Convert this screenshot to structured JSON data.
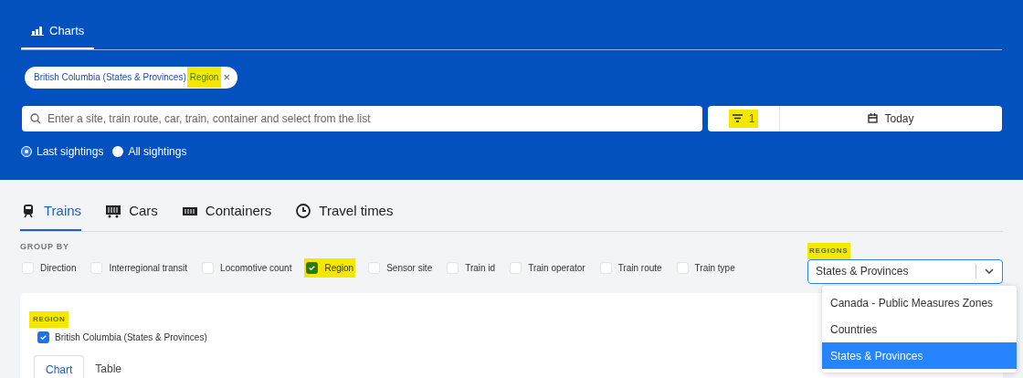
{
  "header_tabs": [
    {
      "label": "Charts",
      "selected": true
    }
  ],
  "filter_chip": {
    "text": "British Columbia (States & Provinces)",
    "tag": "Region",
    "tag_highlighted": true,
    "close": "×"
  },
  "search": {
    "placeholder": "Enter a site, train route, car, train, container and select from the list"
  },
  "filter_button": {
    "count": "1",
    "highlighted": true
  },
  "date_button": {
    "label": "Today"
  },
  "sighting_options": [
    {
      "label": "Last sightings",
      "selected": true
    },
    {
      "label": "All sightings",
      "selected": false
    }
  ],
  "main_tabs": [
    {
      "label": "Trains",
      "kind": "train",
      "selected": true
    },
    {
      "label": "Cars",
      "kind": "car",
      "selected": false
    },
    {
      "label": "Containers",
      "kind": "container",
      "selected": false
    },
    {
      "label": "Travel times",
      "kind": "clock",
      "selected": false
    }
  ],
  "group_by": {
    "title": "GROUP BY",
    "options": [
      {
        "label": "Direction",
        "checked": false,
        "highlighted": false
      },
      {
        "label": "Interregional transit",
        "checked": false,
        "highlighted": false
      },
      {
        "label": "Locomotive count",
        "checked": false,
        "highlighted": false
      },
      {
        "label": "Region",
        "checked": true,
        "highlighted": true
      },
      {
        "label": "Sensor site",
        "checked": false,
        "highlighted": false
      },
      {
        "label": "Train id",
        "checked": false,
        "highlighted": false
      },
      {
        "label": "Train operator",
        "checked": false,
        "highlighted": false
      },
      {
        "label": "Train route",
        "checked": false,
        "highlighted": false
      },
      {
        "label": "Train type",
        "checked": false,
        "highlighted": false
      }
    ]
  },
  "regions": {
    "label": "REGIONS",
    "label_highlighted": true,
    "value": "States & Provinces",
    "options": [
      {
        "label": "Canada - Public Measures Zones",
        "selected": false
      },
      {
        "label": "Countries",
        "selected": false
      },
      {
        "label": "States & Provinces",
        "selected": true
      }
    ]
  },
  "region_filter": {
    "title": "REGION",
    "title_highlighted": true,
    "items": [
      {
        "label": "British Columbia (States & Provinces)",
        "checked": true
      }
    ]
  },
  "view_tabs": [
    {
      "label": "Chart",
      "selected": true
    },
    {
      "label": "Table",
      "selected": false
    }
  ]
}
